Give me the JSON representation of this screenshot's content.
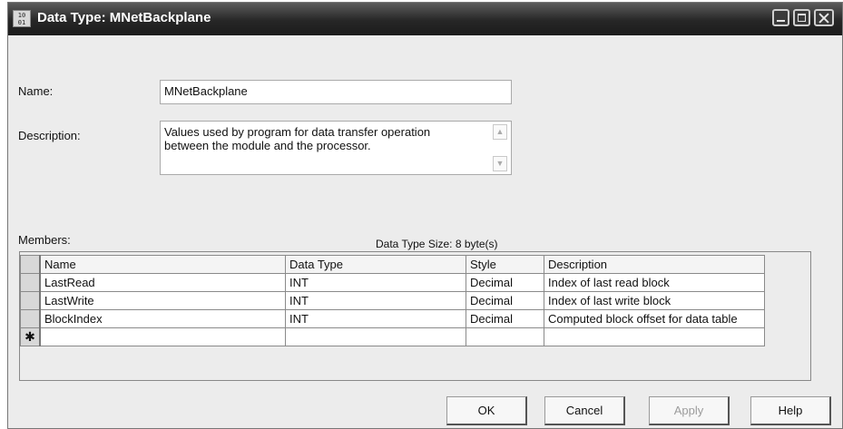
{
  "window": {
    "title": "Data Type:  MNetBackplane",
    "icon_text": "10 01 010"
  },
  "form": {
    "name_label": "Name:",
    "name_value": "MNetBackplane",
    "description_label": "Description:",
    "description_value": "Values used by program for data transfer operation\nbetween the module and the processor."
  },
  "members": {
    "label": "Members:",
    "size_text": "Data Type Size: 8 byte(s)",
    "columns": [
      "Name",
      "Data Type",
      "Style",
      "Description"
    ],
    "rows": [
      {
        "name": "LastRead",
        "data_type": "INT",
        "style": "Decimal",
        "description": "Index of last read block"
      },
      {
        "name": "LastWrite",
        "data_type": "INT",
        "style": "Decimal",
        "description": "Index of last write block"
      },
      {
        "name": "BlockIndex",
        "data_type": "INT",
        "style": "Decimal",
        "description": "Computed block offset for data table"
      }
    ],
    "new_row_marker": "✱"
  },
  "buttons": {
    "ok": "OK",
    "cancel": "Cancel",
    "apply": "Apply",
    "help": "Help"
  }
}
